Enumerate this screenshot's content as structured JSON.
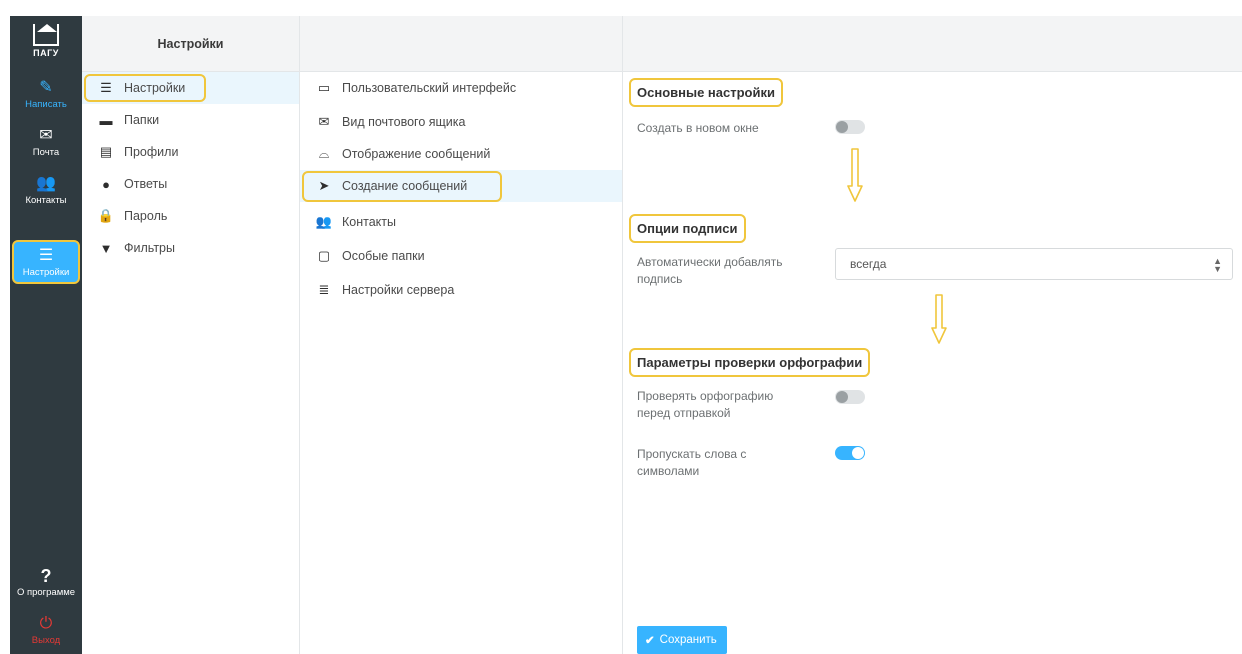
{
  "app": {
    "logo_text": "ПАГУ"
  },
  "taskbar": {
    "compose": {
      "label": "Написать",
      "icon": "pencil-square-icon"
    },
    "mail": {
      "label": "Почта",
      "icon": "envelope-icon"
    },
    "contacts": {
      "label": "Контакты",
      "icon": "users-icon"
    },
    "settings": {
      "label": "Настройки",
      "icon": "sliders-icon"
    },
    "about": {
      "label": "О программе",
      "icon": "question-icon"
    },
    "logout": {
      "label": "Выход",
      "icon": "power-icon"
    }
  },
  "folders_panel": {
    "header": "Настройки",
    "items": [
      {
        "label": "Настройки",
        "icon": "sliders-icon"
      },
      {
        "label": "Папки",
        "icon": "folder-icon"
      },
      {
        "label": "Профили",
        "icon": "id-card-icon"
      },
      {
        "label": "Ответы",
        "icon": "comment-icon"
      },
      {
        "label": "Пароль",
        "icon": "lock-icon"
      },
      {
        "label": "Фильтры",
        "icon": "filter-icon"
      }
    ]
  },
  "sections_panel": {
    "items": [
      {
        "label": "Пользовательский интерфейс",
        "icon": "monitor-icon"
      },
      {
        "label": "Вид почтового ящика",
        "icon": "envelope-outline-icon"
      },
      {
        "label": "Отображение сообщений",
        "icon": "inbox-icon"
      },
      {
        "label": "Создание сообщений",
        "icon": "paper-plane-icon"
      },
      {
        "label": "Контакты",
        "icon": "users-icon"
      },
      {
        "label": "Особые папки",
        "icon": "folder-outline-icon"
      },
      {
        "label": "Настройки сервера",
        "icon": "server-icon"
      }
    ]
  },
  "main": {
    "basic": {
      "title": "Основные настройки",
      "new_window_label": "Создать в новом окне",
      "new_window_on": false
    },
    "signature": {
      "title": "Опции подписи",
      "auto_add_label": "Автоматически добавлять подпись",
      "auto_add_value": "всегда"
    },
    "spell": {
      "title": "Параметры проверки орфографии",
      "check_before_send_label": "Проверять орфографию перед отправкой",
      "check_before_send_on": false,
      "skip_symbols_label": "Пропускать слова с символами",
      "skip_symbols_on": true
    },
    "save_label": "Сохранить"
  },
  "colors": {
    "accent": "#37b4ff",
    "taskbar_bg": "#2f3a40",
    "highlight": "#f0c63c",
    "arrow": "#f0c63c",
    "logout": "#e53935"
  }
}
